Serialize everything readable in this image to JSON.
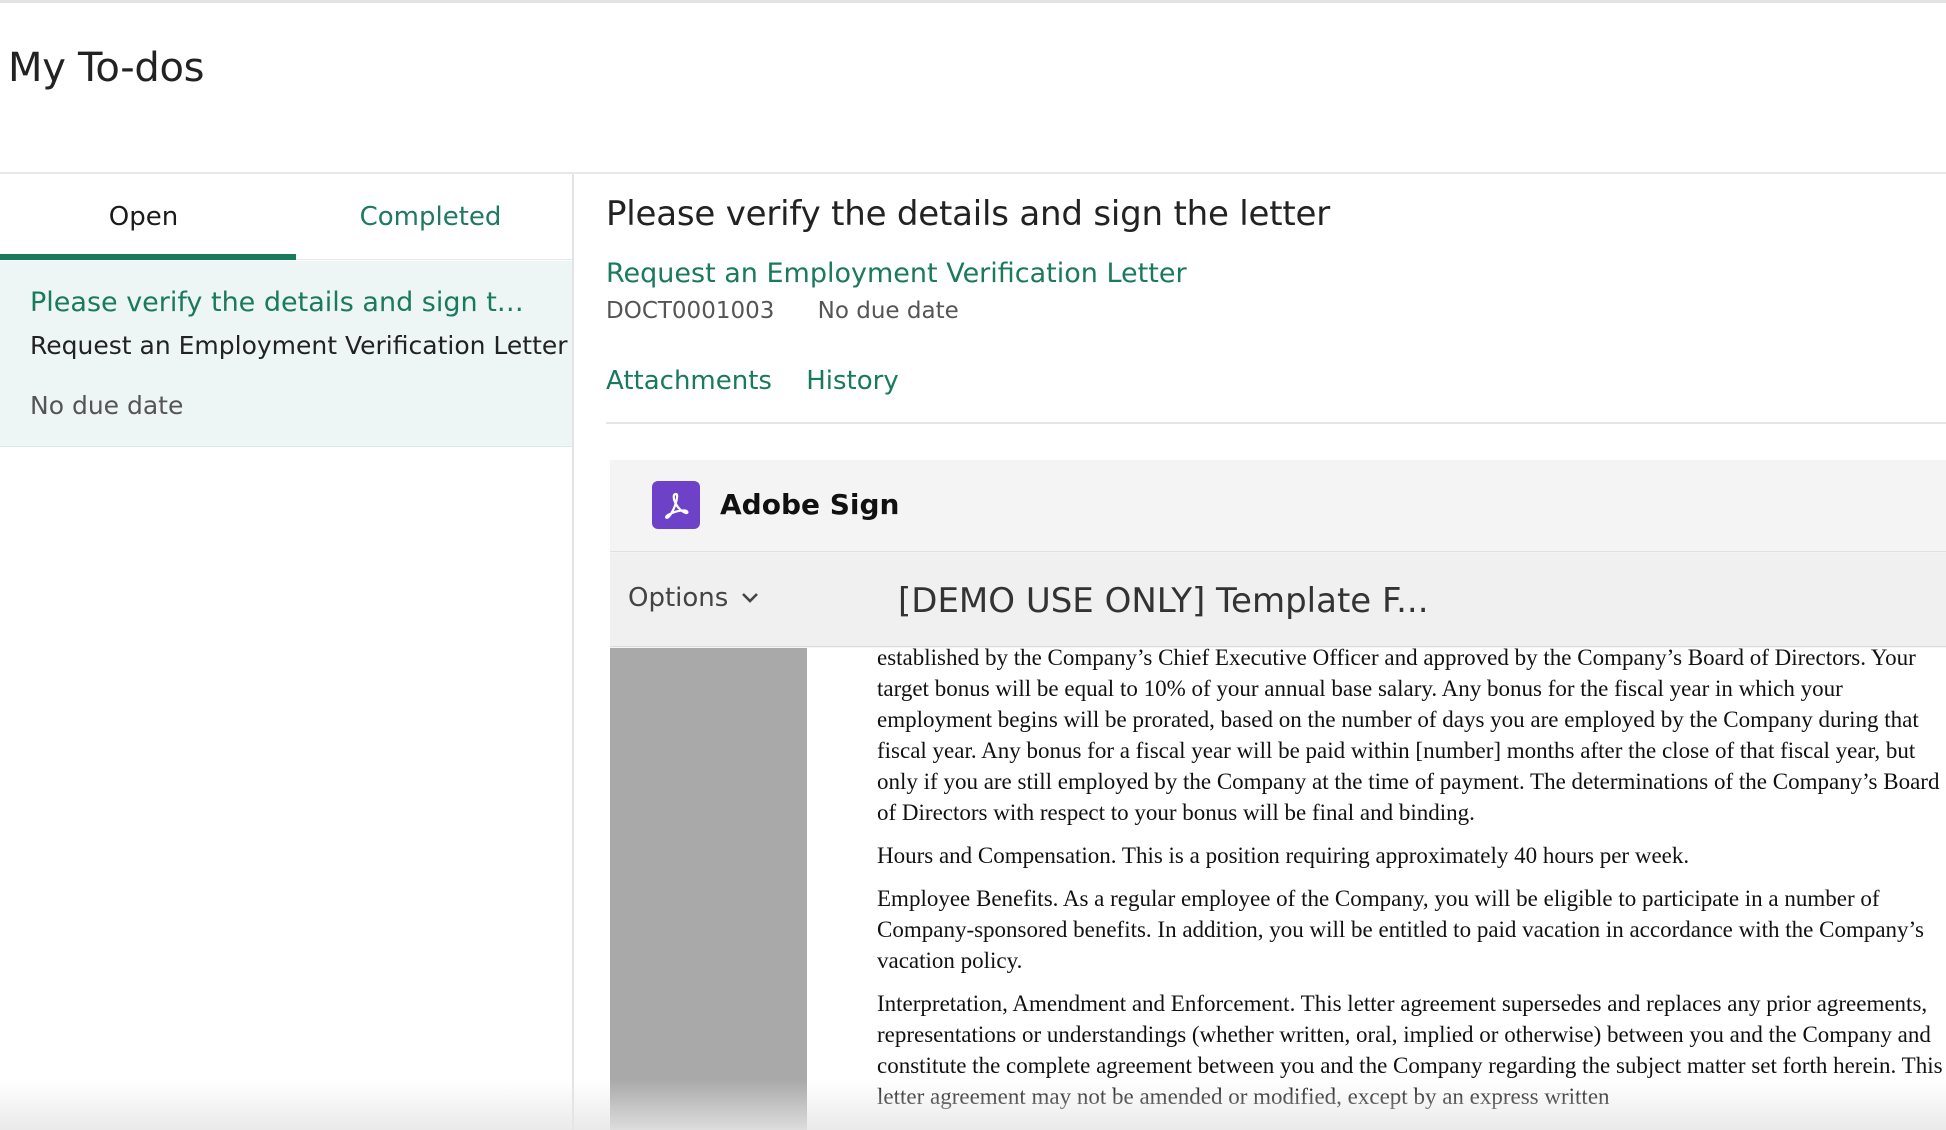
{
  "page": {
    "title": "My To-dos"
  },
  "left_panel": {
    "tabs": [
      {
        "label": "Open",
        "active": true
      },
      {
        "label": "Completed",
        "active": false
      }
    ],
    "todo": {
      "title": "Please verify the details and sign the letter",
      "subtitle": "Request an Employment Verification Letter",
      "due": "No due date"
    }
  },
  "detail": {
    "title": "Please verify the details and sign the letter",
    "request_link": "Request an Employment Verification Letter",
    "doc_number": "DOCT0001003",
    "due": "No due date",
    "tabs": [
      "Attachments",
      "History"
    ]
  },
  "adobe_sign": {
    "brand": "Adobe Sign",
    "icon": "adobe-acrobat-icon",
    "options_label": "Options",
    "doc_title": "[DEMO USE ONLY] Template F...",
    "paragraphs": [
      "established by the Company’s Chief Executive Officer and approved by the Company’s Board of Directors. Your target bonus will be equal to 10% of your annual base salary. Any bonus for the fiscal year in which your employment begins will be prorated, based on the number of days you are employed by the Company during that fiscal year. Any bonus for a fiscal year will be paid within [number] months after the close of that fiscal year, but only if you are still employed by the Company at the time of payment. The determinations of the Company’s Board of Directors with respect to your bonus will be final and binding.",
      "Hours and Compensation. This is a  position requiring approximately 40 hours per week.",
      "Employee Benefits. As a regular employee of the Company, you will be eligible to participate in a number of Company-sponsored benefits. In addition, you will be entitled to paid vacation in accordance with the Company’s vacation policy.",
      "Interpretation, Amendment and Enforcement. This letter agreement supersedes and replaces any prior agreements, representations or understandings (whether written, oral, implied or otherwise) between you and the Company and constitute the complete agreement between you and the Company regarding the subject matter set forth herein. This letter agreement may not be amended or modified, except by an express written"
    ]
  },
  "colors": {
    "accent": "#1a7a5c",
    "card_bg": "#edf5f5",
    "adobe_purple": "#6e42c8",
    "gutter": "#a9a9a9"
  }
}
